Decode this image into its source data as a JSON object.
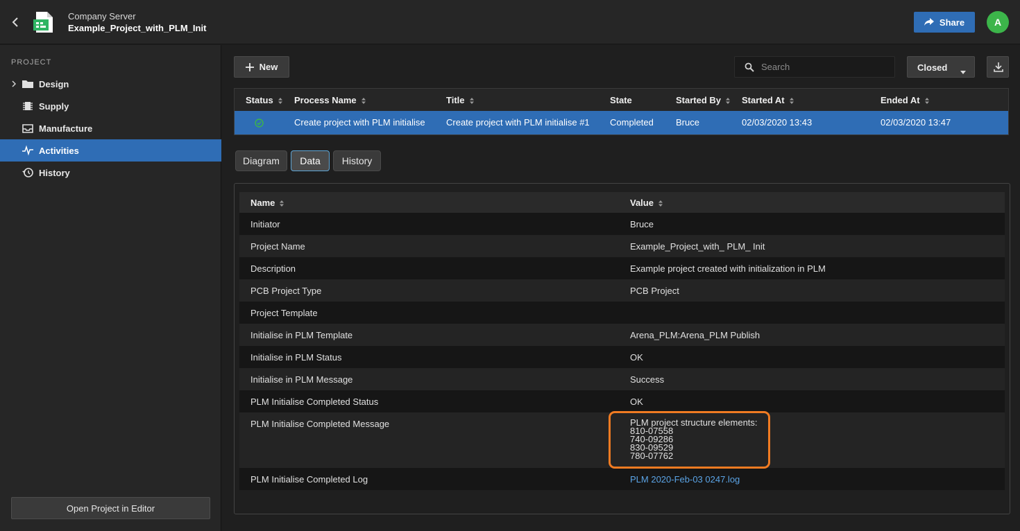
{
  "header": {
    "server_name": "Company Server",
    "project_name": "Example_Project_with_PLM_Init",
    "share_label": "Share",
    "avatar_initial": "A"
  },
  "sidebar": {
    "heading": "PROJECT",
    "items": [
      {
        "label": "Design",
        "icon": "folder-icon"
      },
      {
        "label": "Supply",
        "icon": "chip-icon"
      },
      {
        "label": "Manufacture",
        "icon": "tray-icon"
      },
      {
        "label": "Activities",
        "icon": "activity-icon",
        "active": true
      },
      {
        "label": "History",
        "icon": "history-icon"
      }
    ],
    "open_editor_label": "Open Project in Editor"
  },
  "toolbar": {
    "new_label": "New",
    "search_placeholder": "Search",
    "filter_value": "Closed"
  },
  "process_table": {
    "columns": [
      "Status",
      "Process Name",
      "Title",
      "State",
      "Started By",
      "Started At",
      "Ended At"
    ],
    "rows": [
      {
        "status": "completed",
        "process_name": "Create project with PLM initialise",
        "title": "Create project with PLM initialise #1",
        "state": "Completed",
        "started_by": "Bruce",
        "started_at": "02/03/2020 13:43",
        "ended_at": "02/03/2020 13:47"
      }
    ]
  },
  "tabs": [
    {
      "label": "Diagram"
    },
    {
      "label": "Data",
      "active": true
    },
    {
      "label": "History"
    }
  ],
  "data_table": {
    "columns": [
      "Name",
      "Value"
    ],
    "rows": [
      {
        "name": "Initiator",
        "value": "Bruce"
      },
      {
        "name": "Project Name",
        "value": "Example_Project_with_ PLM_ Init"
      },
      {
        "name": "Description",
        "value": "Example project created with initialization in PLM"
      },
      {
        "name": "PCB Project Type",
        "value": "PCB Project"
      },
      {
        "name": "Project Template",
        "value": ""
      },
      {
        "name": "Initialise in PLM Template",
        "value": "Arena_PLM:Arena_PLM Publish"
      },
      {
        "name": "Initialise in PLM Status",
        "value": "OK"
      },
      {
        "name": "Initialise in PLM Message",
        "value": "Success"
      },
      {
        "name": "PLM Initialise Completed Status",
        "value": "OK"
      },
      {
        "name": "PLM Initialise Completed Message",
        "lines": [
          "PLM project structure elements:",
          "810-07558",
          "740-09286",
          "830-09529",
          "780-07762"
        ]
      },
      {
        "name": "PLM Initialise Completed Log",
        "value": "PLM 2020-Feb-03 0247.log",
        "is_link": true
      }
    ]
  },
  "colors": {
    "accent": "#2f6db5",
    "highlight": "#f07b22",
    "status_ok": "#3cb54a",
    "link": "#5ba4e6"
  }
}
